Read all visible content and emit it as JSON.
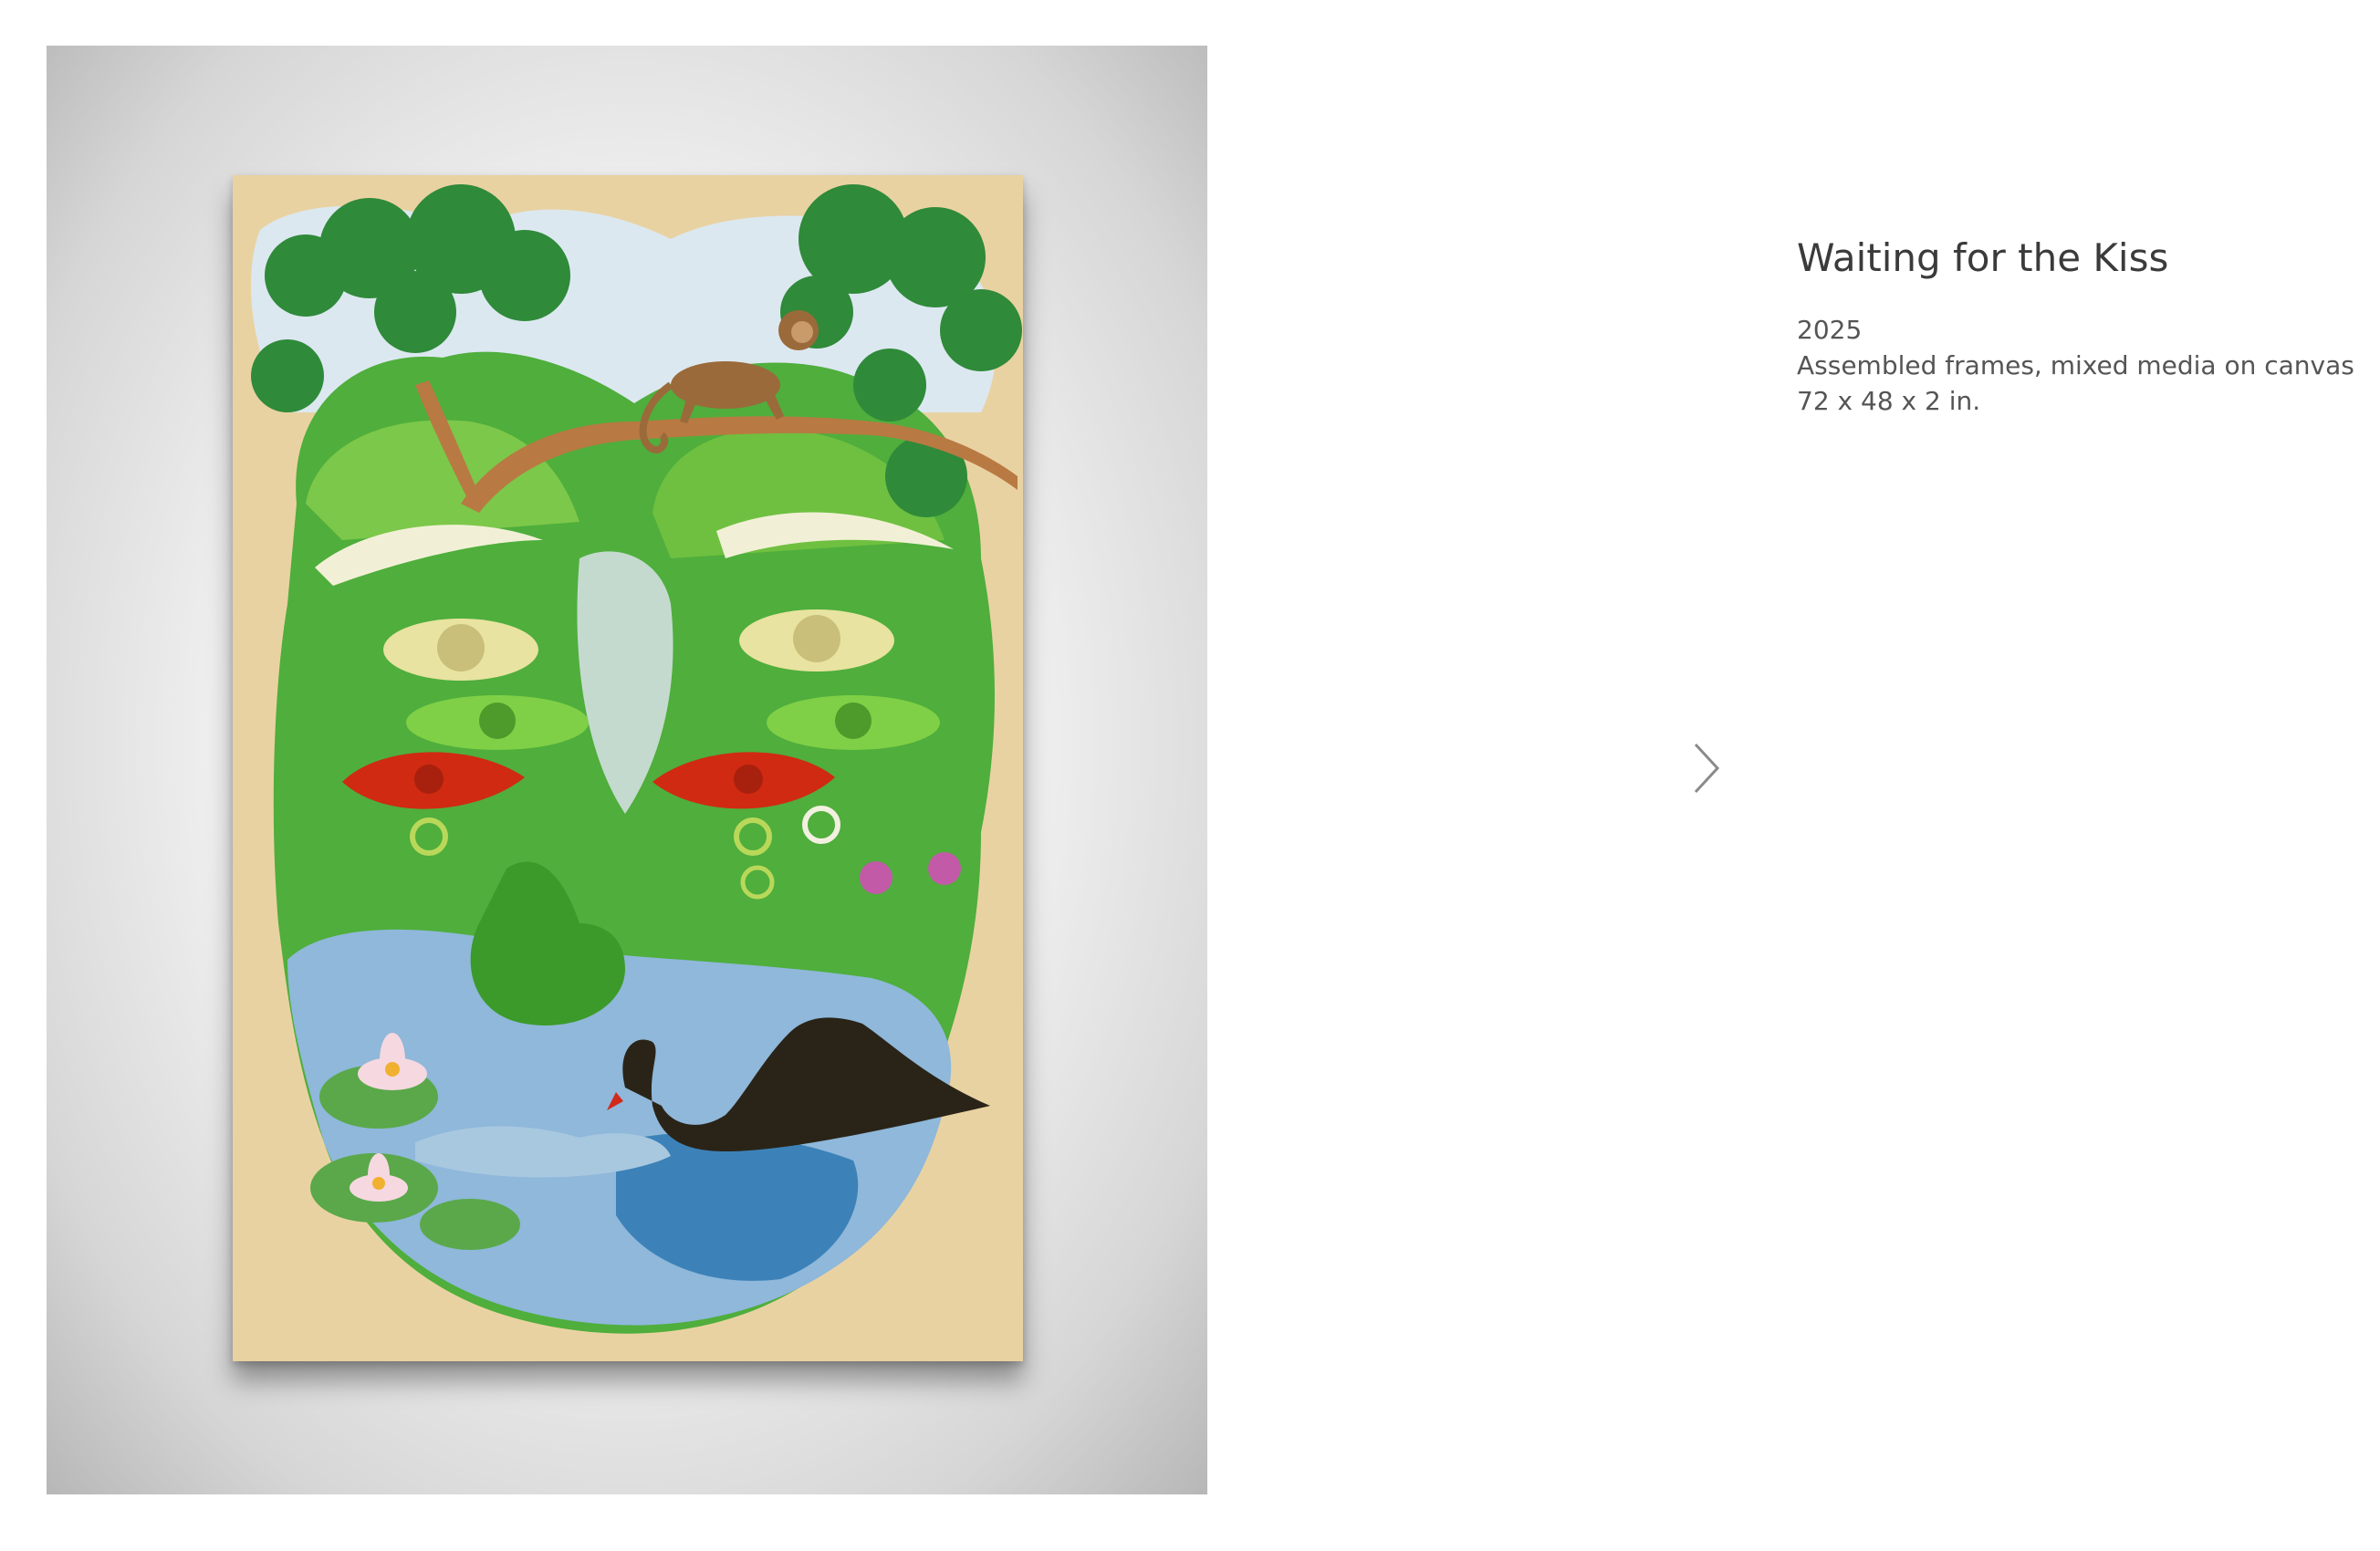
{
  "artwork": {
    "title": "Waiting for the Kiss",
    "year": "2025",
    "medium": "Assembled frames, mixed media on canvas",
    "dimensions": "72 x 48 x 2 in."
  },
  "navigation": {
    "next_icon": "chevron-right-icon"
  },
  "colors": {
    "canvas_bg": "#e9d2a2",
    "foliage": "#2f8a3a",
    "face_green": "#4fae3c",
    "eye_red": "#d02a12",
    "water_blue": "#8fb8da",
    "swan": "#2a2418",
    "arrow": "#8a8a8a"
  }
}
